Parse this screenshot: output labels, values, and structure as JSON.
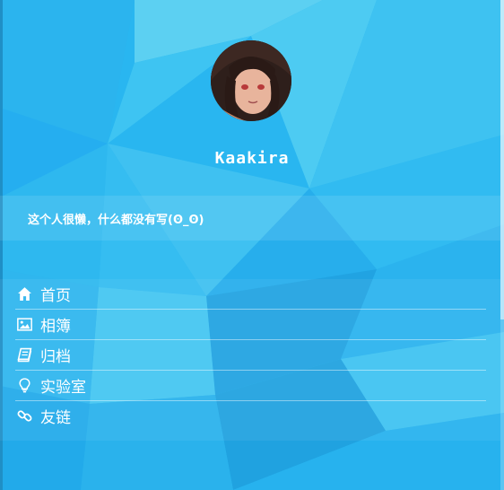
{
  "profile": {
    "username": "Kaakira",
    "bio": "这个人很懒，什么都没有写(ʘ_ʘ)"
  },
  "menu": [
    {
      "label": "首页",
      "icon": "home-icon"
    },
    {
      "label": "相簿",
      "icon": "image-icon"
    },
    {
      "label": "归档",
      "icon": "book-icon"
    },
    {
      "label": "实验室",
      "icon": "lightbulb-icon"
    },
    {
      "label": "友链",
      "icon": "link-icon"
    }
  ],
  "colors": {
    "background": "#29b6f0",
    "text": "#ffffff"
  }
}
